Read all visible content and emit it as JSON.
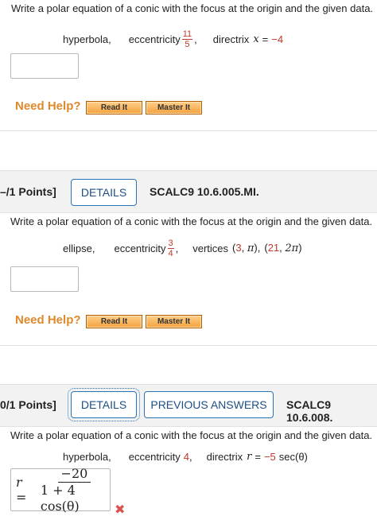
{
  "q1": {
    "prompt": "Write a polar equation of a conic with the focus at the origin and the given data.",
    "type": "hyperbola,",
    "ecc_label": "eccentricity",
    "ecc_num": "11",
    "ecc_den": "5",
    "ecc_comma": ",",
    "directrix_label": "directrix",
    "directrix_var": "x",
    "directrix_eq": "=",
    "directrix_val": "−4",
    "answer_value": "",
    "need_help": "Need Help?",
    "read_it": "Read It",
    "master_it": "Master It"
  },
  "q2": {
    "points": "–/1 Points]",
    "details": "DETAILS",
    "code": "SCALC9 10.6.005.MI.",
    "prompt": "Write a polar equation of a conic with the focus at the origin and the given data.",
    "type": "ellipse,",
    "ecc_label": "eccentricity",
    "ecc_num": "3",
    "ecc_den": "4",
    "ecc_comma": ",",
    "vertices_label": "vertices",
    "v1_open": "(",
    "v1_a": "3",
    "v1_sep": ", ",
    "v1_b": "π",
    "v1_close": "),",
    "v2_open": "(",
    "v2_a": "21",
    "v2_sep": ", ",
    "v2_b": "2π",
    "v2_close": ")",
    "answer_value": "",
    "need_help": "Need Help?",
    "read_it": "Read It",
    "master_it": "Master It"
  },
  "q3": {
    "points": "0/1 Points]",
    "details": "DETAILS",
    "previous": "PREVIOUS ANSWERS",
    "code": "SCALC9 10.6.008.",
    "prompt": "Write a polar equation of a conic with the focus at the origin and the given data.",
    "type": "hyperbola,",
    "ecc_label": "eccentricity",
    "ecc_val": "4",
    "ecc_comma": ",",
    "directrix_label": "directrix",
    "directrix_var": "r",
    "directrix_eq": "=",
    "directrix_val": "−5",
    "directrix_fn": "sec(θ)",
    "answer_lhs": "r =",
    "answer_num": "−20",
    "answer_den": "1 + 4 cos(θ)",
    "result_icon": "incorrect-x-icon"
  }
}
